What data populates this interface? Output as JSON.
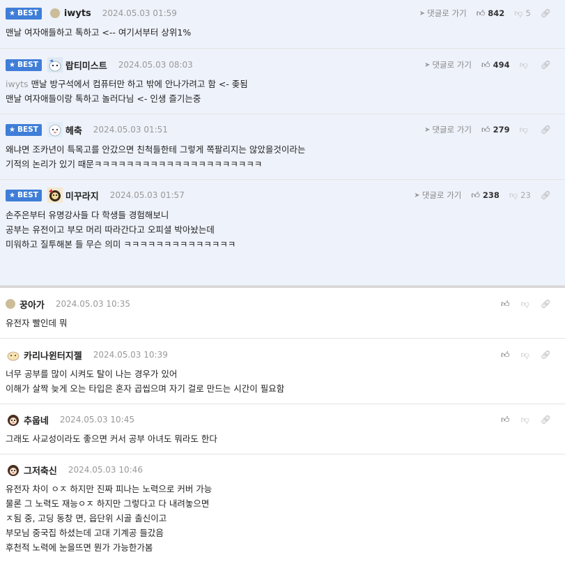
{
  "best_label": "BEST",
  "reply_label": "댓글로 가기",
  "comments": [
    {
      "nick": "iwyts",
      "date": "2024.05.03 01:59",
      "up": "842",
      "down": "5",
      "lines": [
        "맨날 여자애들하고 톡하고 <-- 여기서부터 상위1%"
      ]
    },
    {
      "nick": "랍티미스트",
      "date": "2024.05.03 08:03",
      "up": "494",
      "reply_to": "iwyts",
      "lines": [
        "맨날 방구석에서 컴퓨터만 하고 밖에 안나가려고 함 <- 좆됨",
        "맨날 여자애들이랑 톡하고 놀러다님 <- 인생 즐기는중"
      ]
    },
    {
      "nick": "헤축",
      "date": "2024.05.03 01:51",
      "up": "279",
      "lines": [
        "왜냐면 조카년이 특목고를 안갔으면 친척들한테 그렇게 쪽팔리지는 않았을것이라는",
        "기적의 논리가 있기 때문ㅋㅋㅋㅋㅋㅋㅋㅋㅋㅋㅋㅋㅋㅋㅋㅋㅋㅋㅋㅋㅋ"
      ]
    },
    {
      "nick": "미꾸라지",
      "date": "2024.05.03 01:57",
      "up": "238",
      "down": "23",
      "lines": [
        "손주은부터 유명강사들 다 학생들 경험해보니",
        "",
        "공부는 유전이고 부모 머리 따라간다고 오피셜 박아놨는데",
        "",
        "미워하고 질투해본 들 무슨 의미 ㅋㅋㅋㅋㅋㅋㅋㅋㅋㅋㅋㅋㅋㅋ"
      ]
    },
    {
      "nick": "꿍아가",
      "date": "2024.05.03 10:35",
      "lines": [
        "유전자 빨인데 뭐"
      ]
    },
    {
      "nick": "카리나윈터지젤",
      "date": "2024.05.03 10:39",
      "lines": [
        "너무 공부를 많이 시켜도 탈이 나는 경우가 있어",
        "이해가 살짝 늦게 오는 타입은 혼자 곱씹으며 자기 걸로 만드는 시간이 필요함"
      ]
    },
    {
      "nick": "추웁네",
      "date": "2024.05.03 10:45",
      "lines": [
        "그래도 사교성이라도 좋으면 커서 공부 아녀도 뭐라도 한다"
      ]
    },
    {
      "nick": "그저축신",
      "date": "2024.05.03 10:46",
      "lines": [
        "유전자 차이 ㅇㅈ 하지만 진짜 피나는 노력으로 커버 가능",
        "물론 그 노력도 재능ㅇㅈ 하지만 그렇다고 다 내려놓으면",
        "ㅈ됨 중, 고딩 동창 면, 읍단위 시골 출신이고",
        "부모님 중국집 하셨는데 고대 기계공 들갔음",
        "후천적 노력에 눈을뜨면 뭔가 가능한가봄"
      ]
    }
  ]
}
